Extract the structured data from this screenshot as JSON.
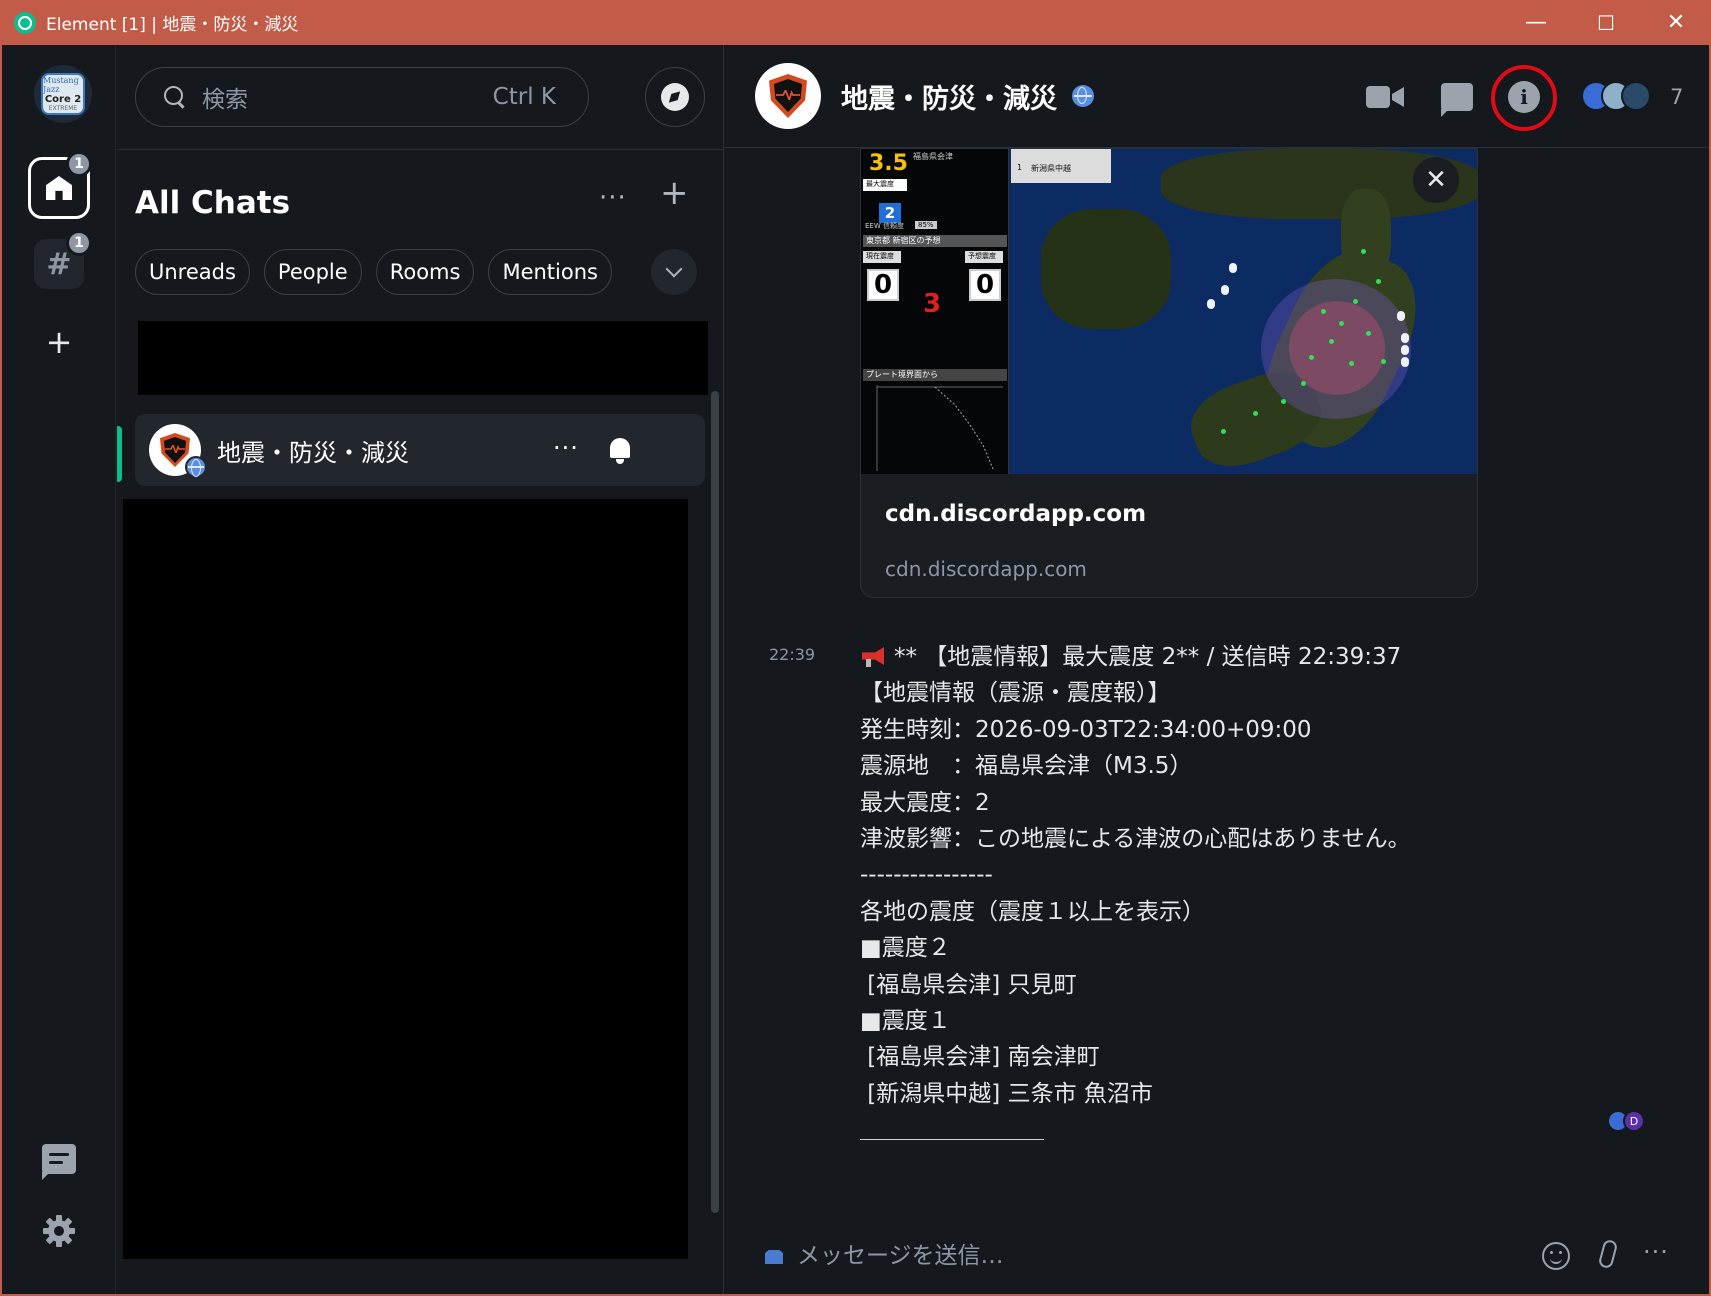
{
  "window": {
    "title": "Element [1] | 地震・防災・減災",
    "minimize": "—",
    "maximize": "☐",
    "close": "✕"
  },
  "rail": {
    "avatar": {
      "line1": "Mustang Jazz",
      "line2": "Core 2",
      "line3": "EXTREME"
    },
    "home_badge": "1",
    "hash_label": "#",
    "hash_badge": "1",
    "add_label": "+"
  },
  "roomlist": {
    "search_placeholder": "検索",
    "search_shortcut": "Ctrl K",
    "heading": "All Chats",
    "more_label": "···",
    "add_label": "+",
    "filters": [
      "Unreads",
      "People",
      "Rooms",
      "Mentions"
    ],
    "room": {
      "name": "地震・防災・減災",
      "more_label": "···"
    }
  },
  "header": {
    "room_name": "地震・防災・減災",
    "info_label": "i",
    "member_count": "7"
  },
  "preview": {
    "image_text": {
      "magnitude": "3.5",
      "location": "福島県会津",
      "max_intensity_label": "最大震度",
      "max_intensity": "2",
      "eew_label": "EEW 信頼度",
      "eew_value": "85%",
      "forecast_label": "東京都 新宿区の予想",
      "current_label": "現在震度",
      "forecast_int_label": "予想震度",
      "current_value": "0",
      "countdown": "3",
      "forecast_value": "0",
      "plate_label": "プレート境界面から",
      "legend_line1": "新潟県中越",
      "legend_num": "1"
    },
    "title": "cdn.discordapp.com",
    "domain": "cdn.discordapp.com",
    "close_label": "✕"
  },
  "message": {
    "time": "22:39",
    "lines": [
      "** 【地震情報】最大震度 2** / 送信時 22:39:37",
      "【地震情報（震源・震度報）】",
      "発生時刻：2026-09-03T22:34:00+09:00",
      "震源地　：福島県会津（M3.5）",
      "最大震度：2",
      "津波影響：この地震による津波の心配はありません。",
      "----------------",
      "各地の震度（震度１以上を表示）",
      "■震度２",
      " [福島県会津] 只見町",
      "■震度１",
      " [福島県会津] 南会津町",
      " [新潟県中越] 三条市 魚沼市",
      "＿＿＿＿＿＿＿＿"
    ],
    "receipt_letter": "D"
  },
  "composer": {
    "placeholder": "メッセージを送信…",
    "more_label": "···"
  },
  "colors": {
    "accent": "#0dbd8b",
    "titlebar": "#c25b47",
    "highlight_ring": "#e00b16",
    "background": "#15191e"
  }
}
